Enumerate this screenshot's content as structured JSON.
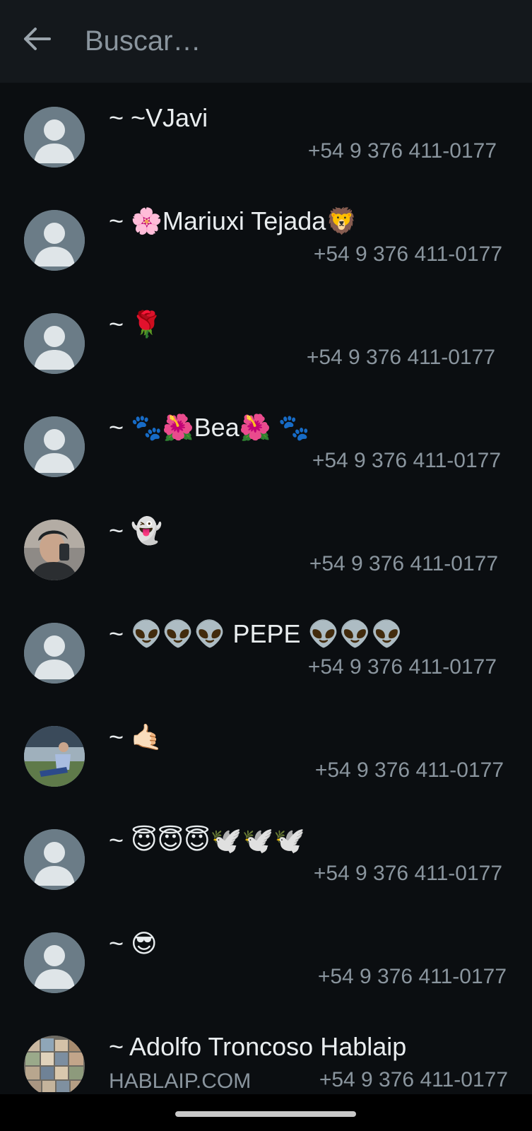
{
  "search": {
    "placeholder": "Buscar…",
    "value": ""
  },
  "icons": {
    "back": "arrow-left-icon",
    "default_avatar": "person-icon"
  },
  "colors": {
    "background": "#0b0e11",
    "topbar": "#14181c",
    "name_text": "#e9edef",
    "secondary_text": "#8a959e",
    "avatar_placeholder": "#6b7c87"
  },
  "contacts": [
    {
      "name": "~ ~VJavi",
      "phone": "+54 9 376 411-0177",
      "avatar": "default"
    },
    {
      "name": "~ 🌸Mariuxi Tejada🦁",
      "phone": "+54 9 376 411-0177",
      "avatar": "default"
    },
    {
      "name": "~ 🌹",
      "phone": "+54 9 376 411-0177",
      "avatar": "default"
    },
    {
      "name": "~ 🐾🌺Bea🌺 🐾",
      "phone": "+54 9 376 411-0177",
      "avatar": "default"
    },
    {
      "name": "~ 👻",
      "phone": "+54 9 376 411-0177",
      "avatar": "photo"
    },
    {
      "name": "~ 👽👽👽 PEPE 👽👽👽",
      "phone": "+54 9 376 411-0177",
      "avatar": "default"
    },
    {
      "name": "~ 🤙🏻",
      "phone": "+54 9 376 411-0177",
      "avatar": "photo"
    },
    {
      "name": "~ 😇😇😇🕊️🕊️🕊️",
      "phone": "+54 9 376 411-0177",
      "avatar": "default"
    },
    {
      "name": "~ 😎",
      "phone": "+54 9 376 411-0177",
      "avatar": "default"
    },
    {
      "name": "~ Adolfo Troncoso Hablaip",
      "subtitle": "HABLAIP.COM",
      "phone": "+54 9 376 411-0177",
      "avatar": "photo"
    }
  ]
}
